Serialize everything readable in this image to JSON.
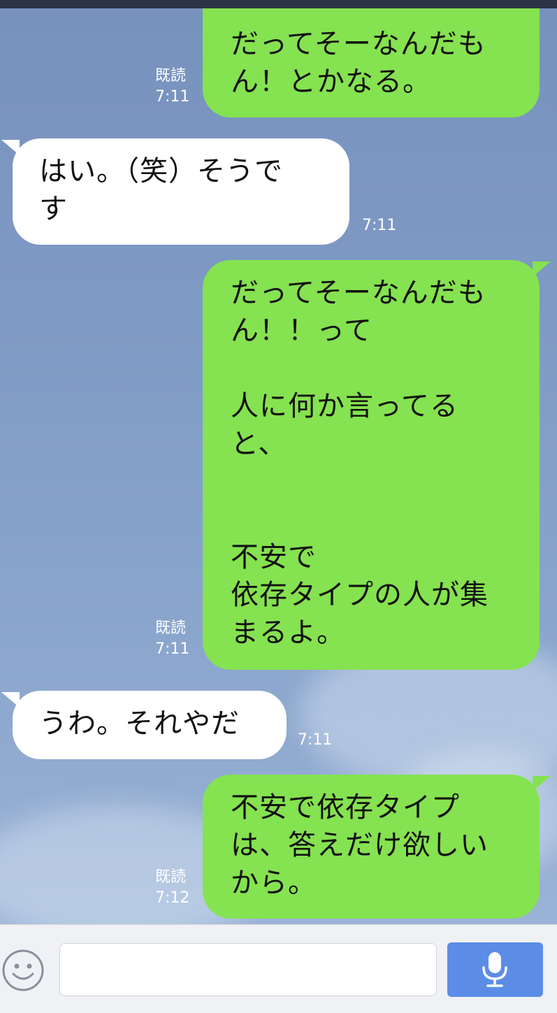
{
  "colors": {
    "outgoing_bubble": "#85e250",
    "incoming_bubble": "#ffffff",
    "background": "#7f9ac4",
    "send_button": "#5b8de6"
  },
  "messages": [
    {
      "dir": "out",
      "text": "だってそーなんだも\nん！とかなる。",
      "read": "既読",
      "time": "7:11"
    },
    {
      "dir": "in",
      "text": "はい。（笑）そうで\nす",
      "time": "7:11"
    },
    {
      "dir": "out",
      "text": "だってそーなんだも\nん！！って\n\n人に何か言ってる\nと、\n\n\n不安で\n依存タイプの人が集\nまるよ。",
      "read": "既読",
      "time": "7:11"
    },
    {
      "dir": "in",
      "text": "うわ。それやだ",
      "time": "7:11"
    },
    {
      "dir": "out",
      "text": "不安で依存タイプ\nは、答えだけ欲しい\nから。",
      "read": "既読",
      "time": "7:12"
    }
  ],
  "input": {
    "placeholder": "",
    "emoji_icon": "smiley-icon",
    "send_icon": "microphone-icon"
  }
}
